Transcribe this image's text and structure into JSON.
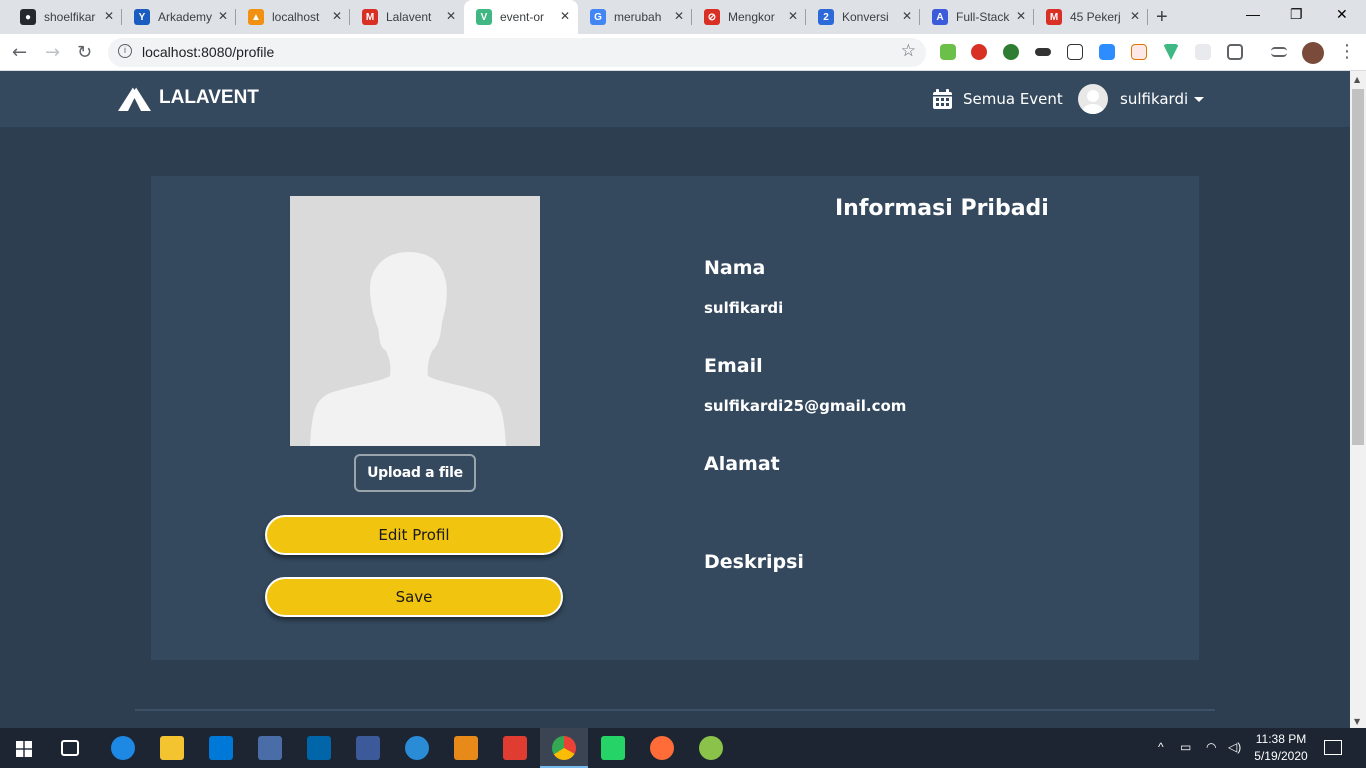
{
  "browser": {
    "tabs": [
      {
        "label": "shoelfikar",
        "fav_color": "#24292e",
        "fav_glyph": "●"
      },
      {
        "label": "Arkademy",
        "fav_color": "#1a5cbf",
        "fav_glyph": "Y"
      },
      {
        "label": "localhost",
        "fav_color": "#f29111",
        "fav_glyph": "▲"
      },
      {
        "label": "Lalavent",
        "fav_color": "#d93025",
        "fav_glyph": "M"
      },
      {
        "label": "event-or",
        "fav_color": "#41b883",
        "fav_glyph": "V"
      },
      {
        "label": "merubah",
        "fav_color": "#4285f4",
        "fav_glyph": "G"
      },
      {
        "label": "Mengkor",
        "fav_color": "#d93025",
        "fav_glyph": "⊘"
      },
      {
        "label": "Konversi",
        "fav_color": "#2b6ad8",
        "fav_glyph": "2"
      },
      {
        "label": "Full-Stack",
        "fav_color": "#3b5bdb",
        "fav_glyph": "A"
      },
      {
        "label": "45 Pekerj",
        "fav_color": "#d93025",
        "fav_glyph": "M"
      }
    ],
    "active_tab_index": 4,
    "url": "localhost:8080/profile",
    "window_controls": {
      "minimize": "—",
      "restore": "❐",
      "close": "✕"
    }
  },
  "navbar": {
    "brand": "LALAVENT",
    "events_link": "Semua Event",
    "username": "sulfikardi"
  },
  "profile": {
    "upload_label": "Upload a file",
    "edit_label": "Edit Profil",
    "save_label": "Save",
    "section_title": "Informasi Pribadi",
    "fields": {
      "name_label": "Nama",
      "name_value": "sulfikardi",
      "email_label": "Email",
      "email_value": "sulfikardi25@gmail.com",
      "address_label": "Alamat",
      "address_value": "",
      "description_label": "Deskripsi",
      "description_value": ""
    }
  },
  "colors": {
    "page_bg": "#2c3e50",
    "navbar_bg": "#34495e",
    "card_bg": "#34495e",
    "button_yellow": "#f1c40f"
  },
  "taskbar": {
    "time": "11:38 PM",
    "date": "5/19/2020"
  }
}
